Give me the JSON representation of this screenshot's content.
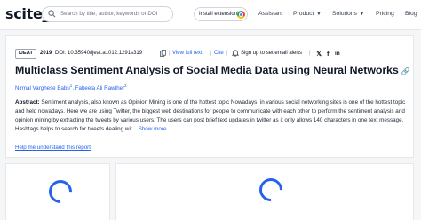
{
  "nav": {
    "logo": "scite_",
    "search_placeholder": "Search by title, author, keywords or DOI",
    "extension_label": "Install extension!",
    "items": [
      {
        "label": "Assistant",
        "dropdown": false
      },
      {
        "label": "Product",
        "dropdown": true
      },
      {
        "label": "Solutions",
        "dropdown": true
      },
      {
        "label": "Pricing",
        "dropdown": false
      },
      {
        "label": "Blog",
        "dropdown": false
      }
    ]
  },
  "paper": {
    "journal_badge": "IJEAT",
    "year": "2019",
    "doi": "DOI: 10.35940/ijeat.a1012.1291s319",
    "view_full_text": "View full text",
    "cite": "Cite",
    "alerts": "Sign up to set email alerts",
    "title": "Multiclass Sentiment Analysis of Social Media Data using Neural Networks",
    "authors": [
      {
        "name": "Nirmal Varghese Babu",
        "sup": "1"
      },
      {
        "name": "Fabeela Ali Rawther",
        "sup": "2"
      }
    ],
    "abstract_label": "Abstract:",
    "abstract_text": "Sentiment analysis, also known as Opinion Mining is one of the hottest topic Nowadays. in various social networking sites is one of the hottest topic and held nowadays. Here we are using Twitter, the biggest web destinations for people to communicate with each other to perform the sentiment analysis and opinion mining by extracting the tweets by various users. The users can post brief text updates in twitter as it only allows 140 characters in one text message. Hashtags helps to search for tweets dealing wit...",
    "show_more": "Show more",
    "help_link": "Help me understand this report"
  },
  "colors": {
    "link": "#2563eb",
    "spinner": "#2563eb",
    "background": "#f4f6f8"
  }
}
